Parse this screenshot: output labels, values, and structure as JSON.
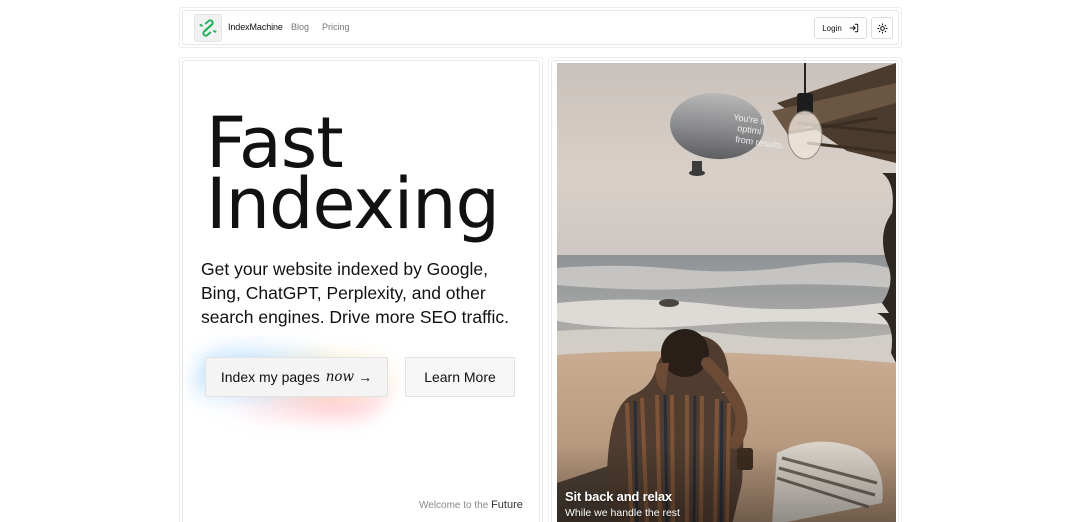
{
  "nav": {
    "brand": "IndexMachine",
    "links": [
      "Blog",
      "Pricing"
    ],
    "login_label": "Login",
    "logo_icon": "link-icon",
    "login_icon": "sign-in-icon",
    "theme_icon": "sun-icon"
  },
  "hero": {
    "title_line1": "Fast",
    "title_line2": "Indexing",
    "subtitle": "Get your website indexed by Google, Bing, ChatGPT, Perplexity, and other search engines. Drive more SEO traffic.",
    "primary_button": {
      "label": "Index my pages",
      "accent": "now",
      "arrow": "→"
    },
    "secondary_button": "Learn More",
    "welcome_prefix": "Welcome to the",
    "welcome_emphasis": "Future"
  },
  "image_card": {
    "blimp_text": "You're optimizing from results.",
    "caption_title": "Sit back and relax",
    "caption_subtitle": "While we handle the rest"
  },
  "colors": {
    "accent_green": "#22b35e",
    "border": "#e6e6e6",
    "text": "#111111",
    "muted": "#777777"
  }
}
